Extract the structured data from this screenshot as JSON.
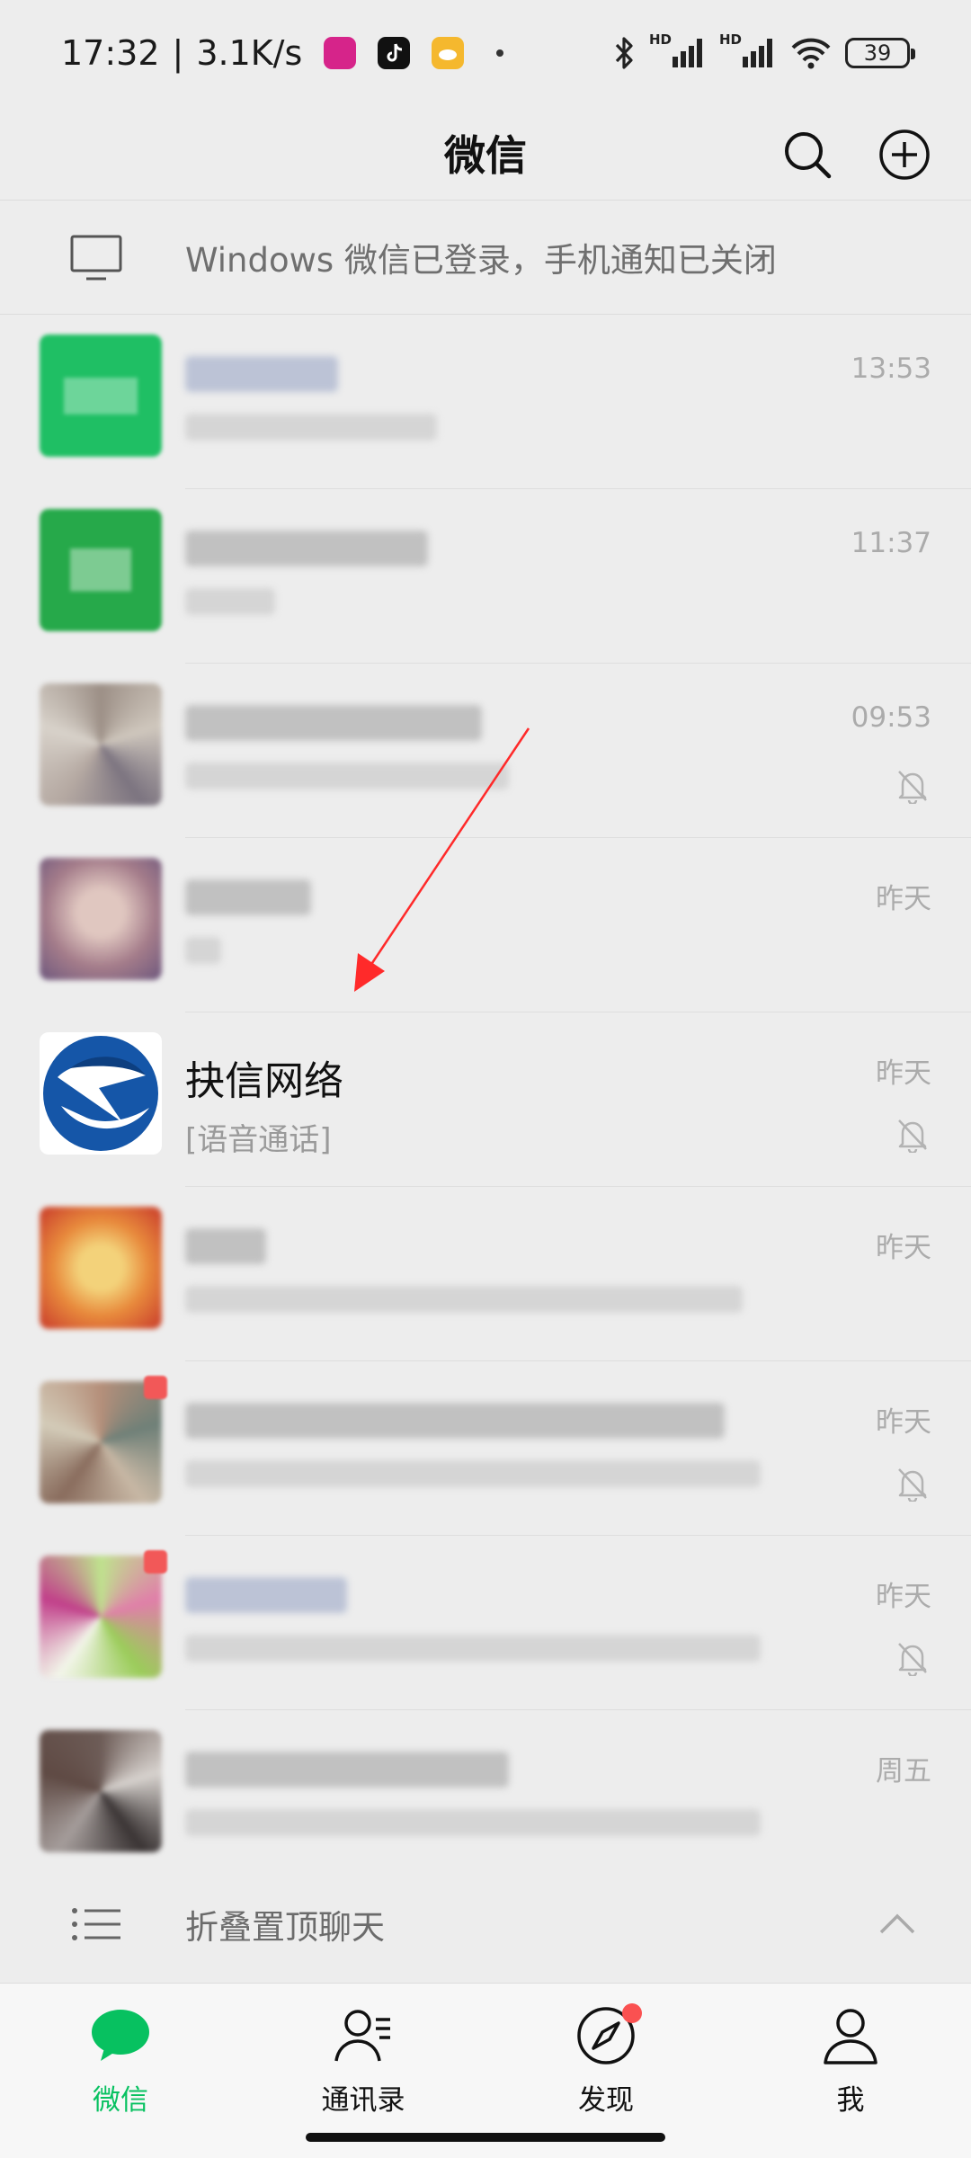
{
  "status_bar": {
    "time": "17:32",
    "network_speed": "3.1K/s",
    "battery": "39",
    "app_icons": [
      "vipshop-icon",
      "tiktok-icon",
      "weather-icon"
    ],
    "app_icon_colors": [
      "#d6248a",
      "#111111",
      "#f5b82e"
    ],
    "signal_labels": [
      "HD",
      "HD"
    ]
  },
  "header": {
    "title": "微信",
    "search_icon": "search-icon",
    "add_icon": "plus-circle-icon"
  },
  "banner": {
    "text": "Windows 微信已登录，手机通知已关闭",
    "icon": "monitor-icon"
  },
  "chats": [
    {
      "name": "",
      "preview": "",
      "time": "13:53",
      "muted": false,
      "obscured": true
    },
    {
      "name": "",
      "preview": "",
      "time": "11:37",
      "muted": false,
      "obscured": true
    },
    {
      "name": "",
      "preview": "",
      "time": "09:53",
      "muted": true,
      "obscured": true
    },
    {
      "name": "",
      "preview": "",
      "time": "昨天",
      "muted": false,
      "obscured": true
    },
    {
      "name": "抉信网络",
      "preview": "[语音通话]",
      "time": "昨天",
      "muted": true,
      "obscured": false
    },
    {
      "name": "",
      "preview": "",
      "time": "昨天",
      "muted": false,
      "obscured": true
    },
    {
      "name": "",
      "preview": "",
      "time": "昨天",
      "muted": true,
      "obscured": true
    },
    {
      "name": "",
      "preview": "",
      "time": "昨天",
      "muted": true,
      "obscured": true
    },
    {
      "name": "",
      "preview": "",
      "time": "周五",
      "muted": false,
      "obscured": true
    }
  ],
  "fold_pinned": {
    "label": "折叠置顶聊天",
    "icon": "list-icon",
    "chevron": "chevron-up-icon"
  },
  "tabbar": {
    "tabs": [
      {
        "label": "微信",
        "icon": "chat-bubble-icon",
        "active": true
      },
      {
        "label": "通讯录",
        "icon": "contacts-icon",
        "active": false
      },
      {
        "label": "发现",
        "icon": "compass-icon",
        "active": false,
        "badge": true
      },
      {
        "label": "我",
        "icon": "person-icon",
        "active": false
      }
    ],
    "active_color": "#07c160",
    "badge_color": "#fa5151"
  },
  "annotation": {
    "color": "#ff2a2a",
    "icon": "red-arrow"
  }
}
